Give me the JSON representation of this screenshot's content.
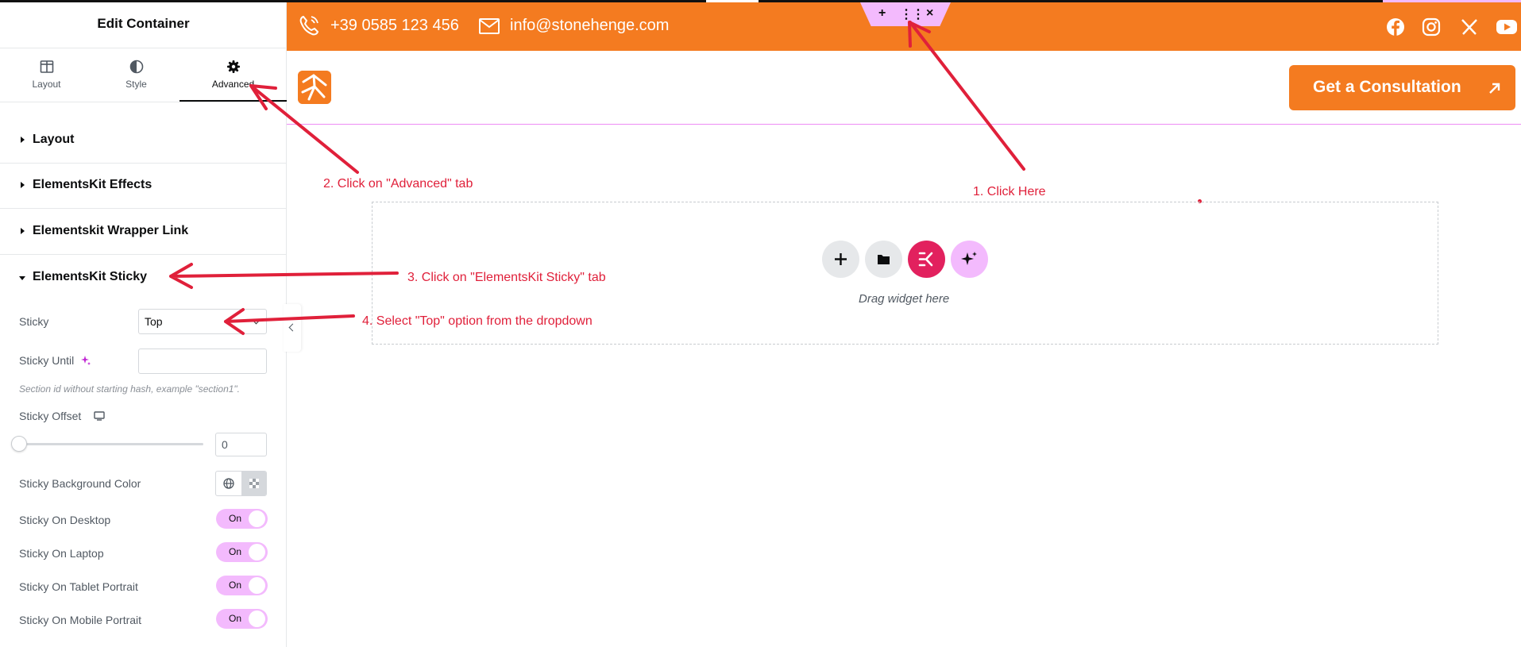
{
  "panel": {
    "title": "Edit Container",
    "tabs": [
      {
        "label": "Layout",
        "icon": "layout-icon"
      },
      {
        "label": "Style",
        "icon": "half-circle-icon"
      },
      {
        "label": "Advanced",
        "icon": "gear-icon",
        "active": true
      }
    ],
    "sections": [
      {
        "label": "Layout",
        "expanded": false
      },
      {
        "label": "ElementsKit Effects",
        "expanded": false
      },
      {
        "label": "Elementskit Wrapper Link",
        "expanded": false
      },
      {
        "label": "ElementsKit Sticky",
        "expanded": true
      }
    ],
    "sticky": {
      "label": "Sticky",
      "value": "Top",
      "until_label": "Sticky Until",
      "until_value": "",
      "hint": "Section id without starting hash, example \"section1\".",
      "offset_label": "Sticky Offset",
      "offset_value": "0",
      "offset_fraction": 0,
      "bg_label": "Sticky Background Color"
    },
    "toggles": [
      {
        "label": "Sticky On Desktop",
        "value": "On"
      },
      {
        "label": "Sticky On Laptop",
        "value": "On"
      },
      {
        "label": "Sticky On Tablet Portrait",
        "value": "On"
      },
      {
        "label": "Sticky On Mobile Portrait",
        "value": "On"
      }
    ]
  },
  "site": {
    "phone": "+39 0585 123 456",
    "email": "info@stonehenge.com",
    "social": [
      "facebook-icon",
      "instagram-icon",
      "x-icon",
      "youtube-icon"
    ],
    "cta": "Get a Consultation",
    "drop_caption": "Drag widget here",
    "handle_icons": [
      "+",
      "⋮⋮",
      "×"
    ]
  },
  "colors": {
    "brand_orange": "#f47b20",
    "editor_pink": "#f3bafd",
    "elementskit_red": "#e2215e",
    "annotation_red": "#e0203a"
  },
  "annotations": [
    "1. Click Here",
    "2. Click on \"Advanced\" tab",
    "3. Click on \"ElementsKit Sticky\" tab",
    "4. Select \"Top\" option from the dropdown"
  ]
}
